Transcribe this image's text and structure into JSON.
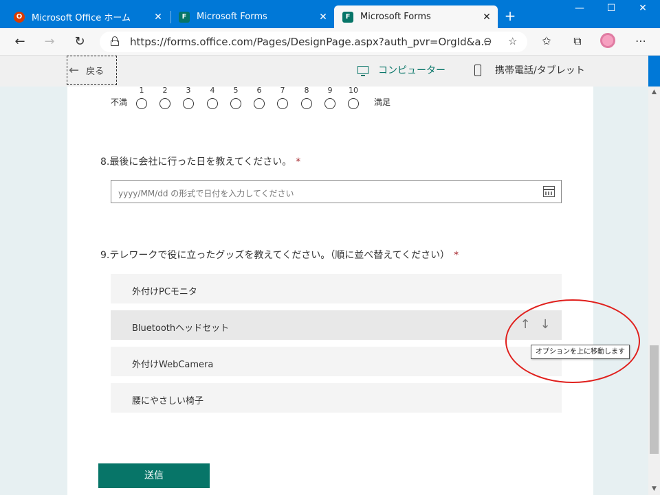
{
  "browser": {
    "tabs": [
      {
        "label": "Microsoft Office ホーム",
        "icon": "office-icon",
        "close": "✕"
      },
      {
        "label": "Microsoft Forms",
        "icon": "forms-icon",
        "close": "✕"
      },
      {
        "label": "Microsoft Forms",
        "icon": "forms-icon",
        "close": "✕",
        "active": true
      }
    ],
    "new_tab": "+",
    "window_controls": {
      "minimize": "—",
      "maximize": "☐",
      "close": "✕"
    },
    "url": "https://forms.office.com/Pages/DesignPage.aspx?auth_pvr=OrgId&a...",
    "accent_color": "#0078d7"
  },
  "forms_header": {
    "back_label": "戻る",
    "view_computer": "コンピューター",
    "view_mobile": "携帯電話/タブレット"
  },
  "scale": {
    "numbers": [
      "1",
      "2",
      "3",
      "4",
      "5",
      "6",
      "7",
      "8",
      "9",
      "10"
    ],
    "left_label": "不満",
    "right_label": "満足"
  },
  "q8": {
    "number": "8.",
    "text": "最後に会社に行った日を教えてください。",
    "required": "*",
    "placeholder": "yyyy/MM/dd の形式で日付を入力してください"
  },
  "q9": {
    "number": "9.",
    "text": "テレワークで役に立ったグッズを教えてください。（順に並べ替えてください）",
    "required": "*",
    "options": [
      "外付けPCモニタ",
      "Bluetoothヘッドセット",
      "外付けWebCamera",
      "腰にやさしい椅子"
    ],
    "move_up": "↑",
    "move_down": "↓",
    "tooltip": "オプションを上に移動します"
  },
  "submit_label": "送信",
  "theme_color": "#077568"
}
